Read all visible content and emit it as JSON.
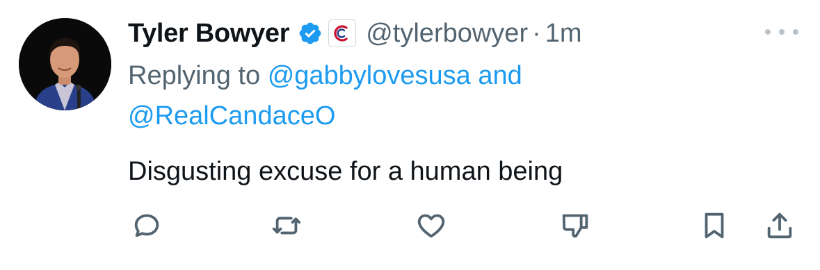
{
  "author": {
    "display_name": "Tyler Bowyer",
    "handle": "@tylerbowyer",
    "separator": "·",
    "time_ago": "1m",
    "avatar_icon": "profile-photo",
    "verified_icon": "verified-badge-icon",
    "affiliate_icon": "affiliate-badge-icon"
  },
  "reply": {
    "prefix": "Replying to",
    "user1": "@gabbylovesusa",
    "conjunction": "and",
    "user2": "@RealCandaceO"
  },
  "tweet": {
    "text": "Disgusting excuse for a human being"
  },
  "actions": [
    {
      "name": "reply",
      "icon": "speech-bubble-icon"
    },
    {
      "name": "retweet",
      "icon": "retweet-icon"
    },
    {
      "name": "like",
      "icon": "heart-icon"
    },
    {
      "name": "downvote",
      "icon": "thumbs-down-icon"
    },
    {
      "name": "bookmark",
      "icon": "bookmark-icon"
    },
    {
      "name": "share",
      "icon": "share-icon"
    }
  ],
  "colors": {
    "text": "#0f1419",
    "secondary": "#536471",
    "link": "#1d9bf0",
    "verified": "#1d9bf0",
    "icon": "#536471"
  }
}
